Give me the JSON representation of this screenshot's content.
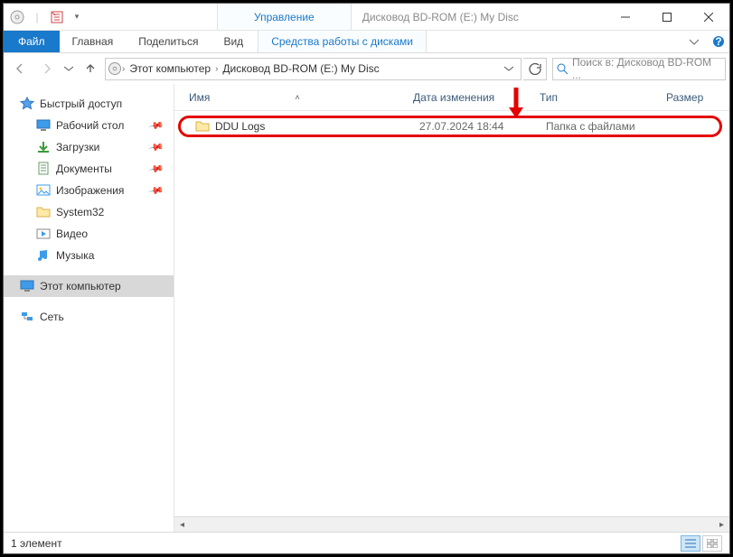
{
  "titlebar": {
    "context": "Управление",
    "title": "Дисковод BD-ROM (E:) My Disc"
  },
  "ribbon": {
    "file": "Файл",
    "tabs": [
      "Главная",
      "Поделиться",
      "Вид"
    ],
    "context_tab": "Средства работы с дисками"
  },
  "address": {
    "crumbs": [
      "Этот компьютер",
      "Дисковод BD-ROM (E:) My Disc"
    ]
  },
  "search": {
    "placeholder": "Поиск в: Дисковод BD-ROM ..."
  },
  "nav": {
    "quick": {
      "label": "Быстрый доступ",
      "items": [
        {
          "label": "Рабочий стол",
          "pin": true,
          "icon": "desktop"
        },
        {
          "label": "Загрузки",
          "pin": true,
          "icon": "downloads"
        },
        {
          "label": "Документы",
          "pin": true,
          "icon": "documents"
        },
        {
          "label": "Изображения",
          "pin": true,
          "icon": "pictures"
        },
        {
          "label": "System32",
          "pin": false,
          "icon": "folder"
        },
        {
          "label": "Видео",
          "pin": false,
          "icon": "videos"
        },
        {
          "label": "Музыка",
          "pin": false,
          "icon": "music"
        }
      ]
    },
    "thispc": "Этот компьютер",
    "network": "Сеть"
  },
  "columns": {
    "name": "Имя",
    "date": "Дата изменения",
    "type": "Тип",
    "size": "Размер"
  },
  "rows": [
    {
      "name": "DDU Logs",
      "date": "27.07.2024 18:44",
      "type": "Папка с файлами",
      "size": ""
    }
  ],
  "status": {
    "count": "1 элемент"
  }
}
